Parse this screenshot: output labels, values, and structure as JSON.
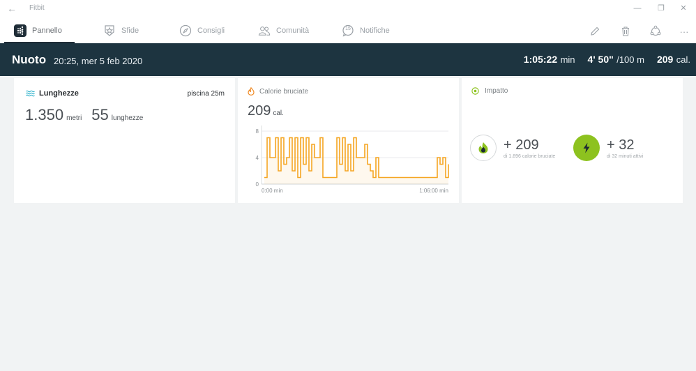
{
  "window": {
    "back_glyph": "←",
    "app_title": "Fitbit",
    "minimize_glyph": "—",
    "restore_glyph": "❐",
    "close_glyph": "✕"
  },
  "nav": {
    "tabs": [
      {
        "label": "Pannello",
        "icon": "fitbit-dots-icon",
        "active": true
      },
      {
        "label": "Sfide",
        "icon": "star-badge-icon",
        "active": false
      },
      {
        "label": "Consigli",
        "icon": "compass-icon",
        "active": false
      },
      {
        "label": "Comunità",
        "icon": "people-icon",
        "active": false
      },
      {
        "label": "Notifiche",
        "icon": "notification-bubble-icon",
        "active": false
      }
    ],
    "notification_count": "15",
    "actions": {
      "edit": "pencil-icon",
      "delete": "trash-icon",
      "share": "share-icon",
      "more_glyph": "···"
    }
  },
  "activity": {
    "title": "Nuoto",
    "datetime": "20:25, mer 5 feb 2020",
    "duration_value": "1:05:22",
    "duration_unit": "min",
    "pace_value": "4' 50\"",
    "pace_unit": "/100 m",
    "calories_value": "209",
    "calories_unit": "cal."
  },
  "laps_card": {
    "title": "Lunghezze",
    "pool": "piscina 25m",
    "distance_value": "1.350",
    "distance_unit": "metri",
    "laps_value": "55",
    "laps_unit": "lunghezze"
  },
  "calories_card": {
    "title": "Calorie bruciate",
    "value": "209",
    "unit": "cal."
  },
  "chart_data": {
    "type": "line",
    "title": "",
    "xlabel": "",
    "ylabel": "",
    "ylim": [
      0,
      8
    ],
    "yticks": [
      0,
      4,
      8
    ],
    "x_tick_labels": [
      "0:00 min",
      "1:06:00 min"
    ],
    "xlim": [
      0,
      66
    ],
    "grid": true,
    "color": "#f5a623",
    "x": [
      0,
      1,
      2,
      3,
      4,
      5,
      6,
      7,
      8,
      9,
      10,
      11,
      12,
      13,
      14,
      15,
      16,
      17,
      18,
      19,
      20,
      21,
      22,
      23,
      24,
      25,
      26,
      27,
      28,
      29,
      30,
      31,
      32,
      33,
      34,
      35,
      36,
      37,
      38,
      39,
      40,
      41,
      42,
      43,
      44,
      45,
      46,
      47,
      48,
      49,
      50,
      51,
      52,
      53,
      54,
      55,
      56,
      57,
      58,
      59,
      60,
      61,
      62,
      63,
      64,
      65,
      66
    ],
    "values": [
      1,
      7,
      4,
      4,
      7,
      2,
      7,
      3,
      4,
      7,
      2,
      7,
      1,
      7,
      3,
      7,
      2,
      6,
      4,
      4,
      7,
      1,
      1,
      1,
      1,
      1,
      7,
      3,
      7,
      2,
      6,
      2,
      7,
      4,
      4,
      4,
      6,
      3,
      2,
      1,
      4,
      1,
      1,
      1,
      1,
      1,
      1,
      1,
      1,
      1,
      1,
      1,
      1,
      1,
      1,
      1,
      1,
      1,
      1,
      1,
      1,
      1,
      4,
      3,
      4,
      1,
      3
    ]
  },
  "impact_card": {
    "title": "Impatto",
    "calories_impact_value": "+ 209",
    "calories_impact_sub": "di 1.896 calorie bruciate",
    "active_impact_value": "+ 32",
    "active_impact_sub": "di 32 minuti attivi",
    "accent_color": "#8dc21f"
  }
}
